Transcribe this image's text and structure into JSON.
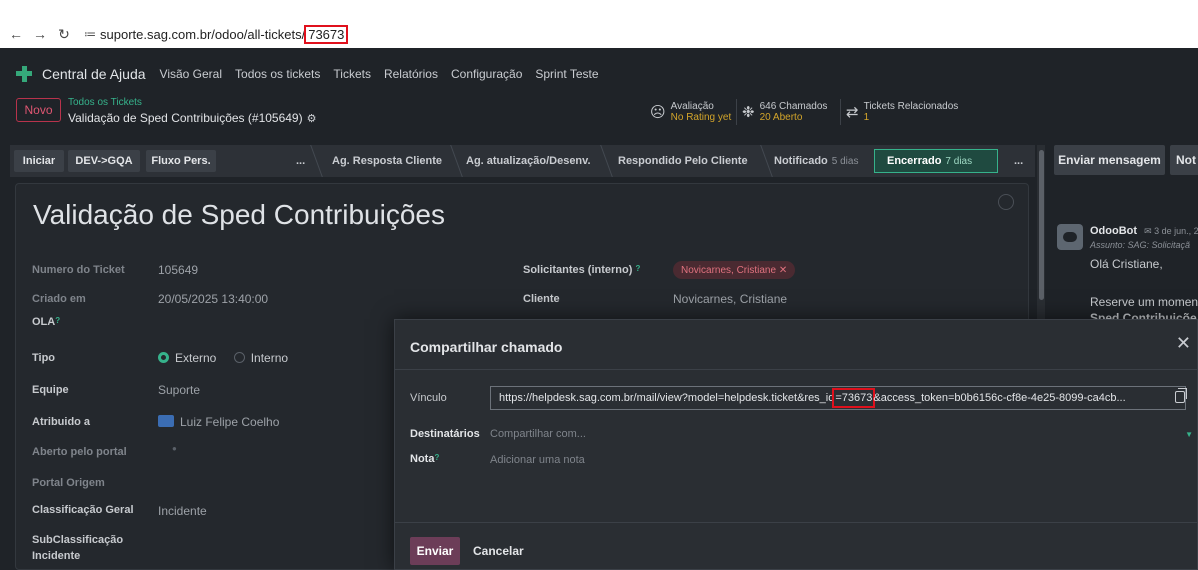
{
  "browser": {
    "url_base": "suporte.sag.com.br/odoo/all-tickets/",
    "url_id": "73673"
  },
  "nav": {
    "app_name": "Central de Ajuda",
    "items": [
      "Visão Geral",
      "Todos os tickets",
      "Tickets",
      "Relatórios",
      "Configuração",
      "Sprint Teste"
    ]
  },
  "control": {
    "new_label": "Novo",
    "breadcrumb_parent": "Todos os Tickets",
    "breadcrumb_current": "Validação de Sped Contribuições (#105649)",
    "rating_label": "Avaliação",
    "rating_value": "No Rating yet",
    "calls_label": "646 Chamados",
    "calls_open": "20 Aberto",
    "related_label": "Tickets Relacionados",
    "related_count": "1"
  },
  "statusbar": {
    "buttons": [
      "Iniciar",
      "DEV->GQA",
      "Fluxo Pers."
    ],
    "more": "...",
    "stages": [
      {
        "label": "Ag. Resposta Cliente",
        "days": ""
      },
      {
        "label": "Ag. atualização/Desenv.",
        "days": ""
      },
      {
        "label": "Respondido Pelo Cliente",
        "days": ""
      },
      {
        "label": "Notificado",
        "days": "5 dias"
      }
    ],
    "active_stage": {
      "label": "Encerrado",
      "days": "7 dias"
    },
    "more_end": "..."
  },
  "ticket": {
    "title": "Validação de Sped Contribuições",
    "fields": {
      "numero_label": "Numero do Ticket",
      "numero_value": "105649",
      "criado_label": "Criado em",
      "criado_value": "20/05/2025 13:40:00",
      "ola_label": "OLA",
      "tipo_label": "Tipo",
      "tipo_opt1": "Externo",
      "tipo_opt2": "Interno",
      "equipe_label": "Equipe",
      "equipe_value": "Suporte",
      "atribuido_label": "Atribuido a",
      "atribuido_value": "Luiz Felipe Coelho",
      "aberto_label": "Aberto pelo portal",
      "portal_label": "Portal Origem",
      "class_label": "Classificação Geral",
      "class_value": "Incidente",
      "subclass_label_1": "SubClassificação",
      "subclass_label_2": "Incidente",
      "solicitantes_label": "Solicitantes (interno)",
      "solicitantes_tag": "Novicarnes, Cristiane",
      "cliente_label": "Cliente",
      "cliente_value": "Novicarnes, Cristiane"
    }
  },
  "chatter": {
    "send_message": "Enviar mensagem",
    "note_label": "Not",
    "author": "OdooBot",
    "date": "3 de jun., 2",
    "subject": "Assunto: SAG: Solicitaçã",
    "greeting": "Olá Cristiane,",
    "body_start": "Reserve um moment",
    "body_bold": "Sped Contribuiçõe"
  },
  "modal": {
    "title": "Compartilhar chamado",
    "vinculo_label": "Vínculo",
    "link_before": "https://helpdesk.sag.com.br/mail/view?model=helpdesk.ticket&res_id",
    "link_hl": "=73673",
    "link_after": "&access_token=b0b6156c-cf8e-4e25-8099-ca4cb...",
    "dest_label": "Destinatários",
    "dest_placeholder": "Compartilhar com...",
    "nota_label": "Nota",
    "nota_placeholder": "Adicionar uma nota",
    "send_label": "Enviar",
    "cancel_label": "Cancelar"
  }
}
